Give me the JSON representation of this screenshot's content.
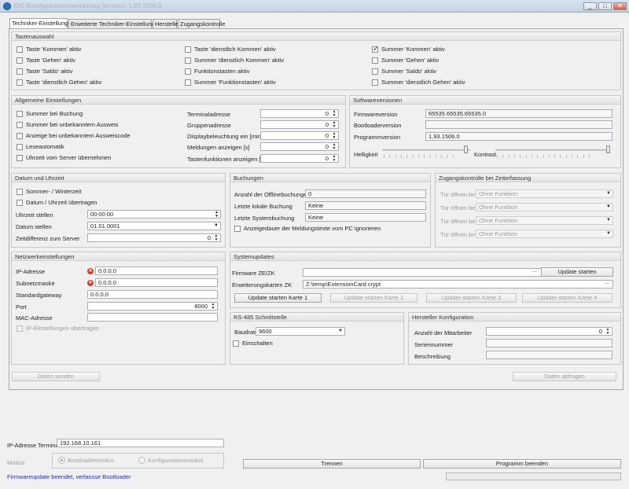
{
  "window": {
    "title": "IDC Konfigurationswerkzeug Version: 1.93.1506.0",
    "min": "_",
    "max": "□",
    "close": "✕"
  },
  "tabs": [
    "Techniker-Einstellungen",
    "Erweiterte Techniker-Einstellungen",
    "Hersteller",
    "Zugangskontrolle"
  ],
  "tastenauswahl": {
    "title": "Tastenauswahl",
    "col1": [
      "Taste 'Kommen' aktiv",
      "Taste 'Gehen' aktiv",
      "Taste 'Saldo' aktiv",
      "Taste 'dienstlich Gehen' aktiv"
    ],
    "col2": [
      "Taste 'dienstlich Kommen' aktiv",
      "Summer 'dienstlich Kommen' aktiv",
      "Funktionstasten aktiv",
      "Summer 'Funktionstasten' aktiv"
    ],
    "col3": [
      "Summer 'Kommen' aktiv",
      "Summer 'Gehen' aktiv",
      "Summer 'Saldo' aktiv",
      "Summer 'dienstlich Gehen' aktiv"
    ]
  },
  "allgemein": {
    "title": "Allgemeine Einstellungen",
    "checks": [
      "Summer bei Buchung",
      "Summer bei unbekanntem Ausweis",
      "Anzeige bei unbekanntem Ausweiscode",
      "Leseautomatik",
      "Uhrzeit vom Server übernehmen"
    ],
    "fields": [
      {
        "label": "Terminaladresse",
        "value": "0"
      },
      {
        "label": "Gruppenadresse",
        "value": "0"
      },
      {
        "label": "Displaybeleuchtung ein [min]",
        "value": "0"
      },
      {
        "label": "Meldungen anzeigen [s]",
        "value": "0"
      },
      {
        "label": "Tastenfunktionen anzeigen [s]",
        "value": "0"
      }
    ]
  },
  "software": {
    "title": "Softwareversionen",
    "firmware_label": "Firmwareversion",
    "firmware_value": "65535.65535.65535.0",
    "bootloader_label": "Bootloaderversion",
    "bootloader_value": "",
    "programm_label": "Programmversion",
    "programm_value": "1.93.1506.0",
    "helligkeit": "Helligkeit",
    "kontrast": "Kontrast",
    "helligkeit_level": 0.97,
    "kontrast_level": 1.0
  },
  "datum": {
    "title": "Datum und Uhrzeit",
    "sommer": "Sommer- / Winterzeit",
    "uebertragen": "Datum / Uhrzeit übertragen",
    "uhrzeit_label": "Uhrzeit stellen",
    "uhrzeit_value": "00:00:00",
    "datum_label": "Datum stellen",
    "datum_value": "01.01.0001",
    "zeitdiff_label": "Zeitdifferenz zum Server",
    "zeitdiff_value": "0"
  },
  "buchungen": {
    "title": "Buchungen",
    "offline_label": "Anzahl der Offlinebuchungen",
    "offline_value": "0",
    "lokal_label": "Letzte lokale Buchung",
    "lokal_value": "Keine",
    "system_label": "Letzte Systembuchung",
    "system_value": "Keine",
    "anzeige_check": "Anzeigedauer der Meldungstexte vom PC ignorieren"
  },
  "zugang": {
    "title": "Zugangskontrolle bei Zeiterfassung",
    "rows": [
      {
        "label": "Tür öffnen bei",
        "value": "Ohne Funktion"
      },
      {
        "label": "Tür öffnen bei",
        "value": "Ohne Funktion"
      },
      {
        "label": "Tür öffnen bei",
        "value": "Ohne Funktion"
      },
      {
        "label": "Tür öffnen bei",
        "value": "Ohne Funktion"
      }
    ]
  },
  "netz": {
    "title": "Netzwerkeinstellungen",
    "ip_label": "IP-Adresse",
    "ip_value": "0.0.0.0",
    "subnet_label": "Subnetzmaske",
    "subnet_value": "0.0.0.0",
    "gateway_label": "Standardgateway",
    "gateway_value": "0.0.0.0",
    "port_label": "Port",
    "port_value": "8000",
    "mac_label": "MAC-Adresse",
    "mac_value": "",
    "ip_check": "IP-Einstellungen übertragen"
  },
  "sysupdate": {
    "title": "Systemupdates",
    "fw_label": "Firmware ZE/ZK",
    "fw_value": "",
    "fw_browse": "...",
    "fw_button": "Update starten",
    "ext_label": "Erweiterungskarten ZK",
    "ext_value": "Z:\\temp\\ExtensionCard.crypt",
    "ext_browse": "...",
    "cards": [
      "Update starten Karte 1",
      "Update starten Karte 2",
      "Update starten Karte 3",
      "Update starten Karte 4"
    ]
  },
  "rs485": {
    "title": "RS-485 Schnittstelle",
    "baud_label": "Baudrate",
    "baud_value": "9600",
    "einschalten": "Einschalten"
  },
  "hersteller": {
    "title": "Hersteller Konfiguration",
    "mit_label": "Anzahl der Mitarbeiter",
    "mit_value": "0",
    "serie_label": "Seriennummer",
    "serie_value": "",
    "beschr_label": "Beschreibung",
    "beschr_value": ""
  },
  "actions": {
    "senden": "Daten senden",
    "abfragen": "Daten abfragen"
  },
  "bottom": {
    "ip_label": "IP-Adresse Terminal",
    "ip_value": "192.168.10.161",
    "modus_label": "Modus",
    "boot": "Bootloadermodus",
    "konfig": "Konfigurationsmodus",
    "trennen": "Trennen",
    "beenden": "Programm beenden",
    "status": "Firmwareupdate beendet, verlassse Bootloader",
    "status_color": "#1b2fb0"
  }
}
